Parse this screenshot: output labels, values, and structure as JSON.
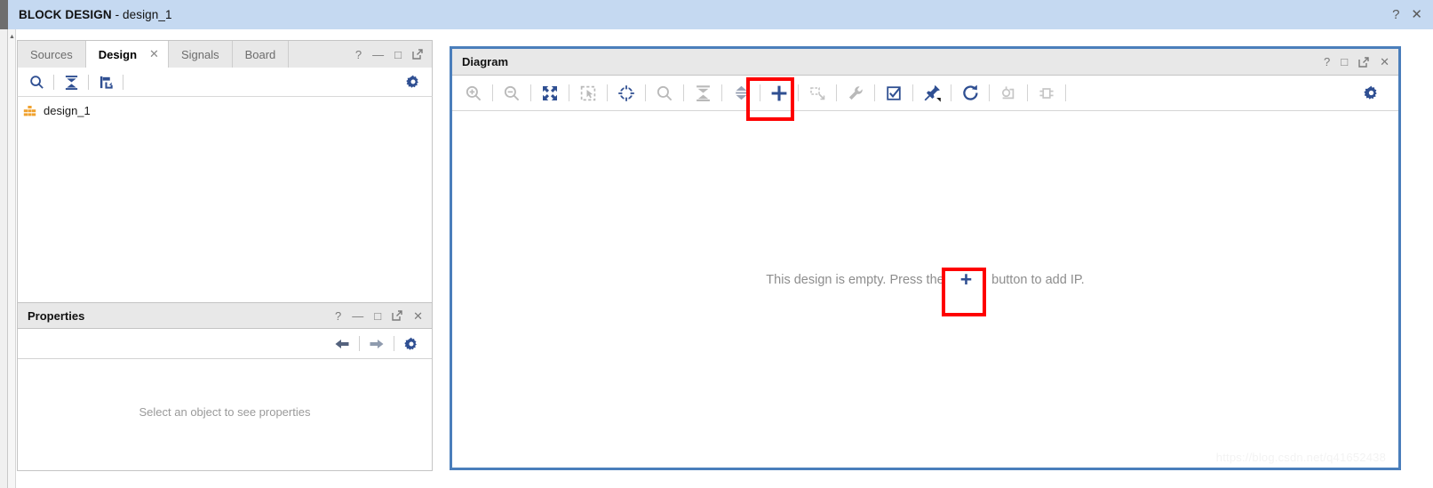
{
  "window": {
    "title_bold": "BLOCK DESIGN",
    "title_rest": " - design_1",
    "help_icon": "?",
    "close_icon": "✕"
  },
  "left_panel": {
    "tabs": [
      {
        "label": "Sources",
        "active": false,
        "closable": false
      },
      {
        "label": "Design",
        "active": true,
        "closable": true
      },
      {
        "label": "Signals",
        "active": false,
        "closable": false
      },
      {
        "label": "Board",
        "active": false,
        "closable": false
      }
    ],
    "tab_close_icon": "✕",
    "window_controls": [
      {
        "name": "help",
        "glyph": "?"
      },
      {
        "name": "minimize",
        "glyph": "—"
      },
      {
        "name": "maximize",
        "glyph": "□"
      },
      {
        "name": "float",
        "glyph": "↗"
      }
    ],
    "toolbar": [
      {
        "name": "search-icon",
        "enabled": true
      },
      {
        "name": "collapse-all-icon",
        "enabled": true
      },
      {
        "name": "expand-hierarchy-icon",
        "enabled": true
      }
    ],
    "settings_icon": "gear-icon",
    "tree": [
      {
        "label": "design_1",
        "icon": "block-design-icon"
      }
    ]
  },
  "properties_panel": {
    "title": "Properties",
    "window_controls": [
      {
        "name": "help",
        "glyph": "?"
      },
      {
        "name": "minimize",
        "glyph": "—"
      },
      {
        "name": "maximize",
        "glyph": "□"
      },
      {
        "name": "float",
        "glyph": "↗"
      },
      {
        "name": "close",
        "glyph": "✕"
      }
    ],
    "nav_back_icon": "arrow-left-icon",
    "nav_forward_icon": "arrow-right-icon",
    "settings_icon": "gear-icon",
    "empty_text": "Select an object to see properties"
  },
  "diagram_panel": {
    "title": "Diagram",
    "window_controls": [
      {
        "name": "help",
        "glyph": "?"
      },
      {
        "name": "maximize",
        "glyph": "□"
      },
      {
        "name": "float",
        "glyph": "↗"
      },
      {
        "name": "close",
        "glyph": "✕"
      }
    ],
    "toolbar": [
      {
        "name": "zoom-in-icon",
        "enabled": false,
        "highlighted": false
      },
      {
        "name": "zoom-out-icon",
        "enabled": false,
        "highlighted": false
      },
      {
        "name": "zoom-fit-icon",
        "enabled": true,
        "highlighted": false
      },
      {
        "name": "zoom-area-icon",
        "enabled": false,
        "highlighted": false
      },
      {
        "name": "center-view-icon",
        "enabled": true,
        "highlighted": false
      },
      {
        "name": "search-icon",
        "enabled": false,
        "highlighted": false
      },
      {
        "name": "collapse-all-icon",
        "enabled": false,
        "highlighted": false
      },
      {
        "name": "expand-resize-icon",
        "enabled": false,
        "highlighted": false
      },
      {
        "name": "add-ip-icon",
        "enabled": true,
        "highlighted": true
      },
      {
        "name": "add-module-icon",
        "enabled": false,
        "highlighted": false
      },
      {
        "name": "settings-wrench-icon",
        "enabled": false,
        "highlighted": false
      },
      {
        "name": "validate-design-icon",
        "enabled": true,
        "highlighted": false
      },
      {
        "name": "pin-icon",
        "enabled": true,
        "highlighted": false
      },
      {
        "name": "regenerate-layout-icon",
        "enabled": true,
        "highlighted": false
      },
      {
        "name": "clock-wizard-icon",
        "enabled": false,
        "highlighted": false
      },
      {
        "name": "interface-block-icon",
        "enabled": false,
        "highlighted": false
      }
    ],
    "settings_icon": "gear-icon",
    "canvas": {
      "empty_message_before": "This design is empty. Press the",
      "empty_message_plus": "+",
      "empty_message_after": "button to add IP.",
      "watermark": "https://blog.csdn.net/q41652438"
    }
  },
  "colors": {
    "title_bar": "#c5d9f1",
    "panel_header": "#e8e8e8",
    "accent_blue": "#2f4f92",
    "focus_border": "#4a7ebb",
    "highlight_red": "#fe0000",
    "disabled_gray": "#b5b5b5",
    "tree_icon_orange": "#f0a22e"
  }
}
